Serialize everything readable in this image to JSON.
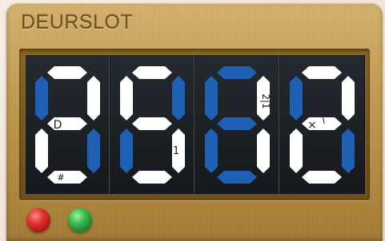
{
  "lock": {
    "title": "DEURSLOT",
    "colors": {
      "segment_off": "#ffffff",
      "segment_on": "#1f5fb4",
      "panel": "#c39c52",
      "display_bg": "#1a1e22"
    },
    "digits": [
      {
        "on": [
          "tl",
          "br"
        ],
        "marks": [
          {
            "text": "D",
            "seg": "mid"
          },
          {
            "text": "#",
            "seg": "bot"
          }
        ]
      },
      {
        "on": [
          "tr",
          "bl"
        ],
        "marks": [
          {
            "text": "1",
            "seg": "br"
          }
        ]
      },
      {
        "on": [
          "top",
          "tl",
          "mid",
          "bl",
          "bot"
        ],
        "marks": [
          {
            "text": "2|1",
            "seg": "tr"
          }
        ]
      },
      {
        "on": [
          "tl",
          "br"
        ],
        "marks": [
          {
            "text": "×",
            "seg": "mid"
          },
          {
            "text": "/",
            "seg": "mid2"
          }
        ]
      }
    ],
    "indicators": [
      {
        "name": "red",
        "color": "#e23434",
        "label": ""
      },
      {
        "name": "green",
        "color": "#37b84a",
        "label": ""
      }
    ]
  }
}
